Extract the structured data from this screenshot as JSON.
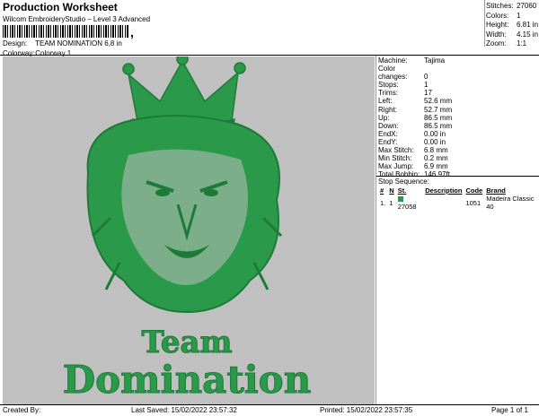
{
  "header": {
    "title": "Production Worksheet",
    "software": "Wilcom EmbroideryStudio – Level 3 Advanced",
    "barcode_suffix": ",",
    "design_label": "Design:",
    "design_value": "TEAM NOMINATION 6,8 in",
    "colorway_label": "Colorway:",
    "colorway_value": "Colorway 1"
  },
  "stats": [
    {
      "label": "Stitches:",
      "value": "27060"
    },
    {
      "label": "Colors:",
      "value": "1"
    },
    {
      "label": "Height:",
      "value": "6.81 in"
    },
    {
      "label": "Width:",
      "value": "4.15 in"
    },
    {
      "label": "Zoom:",
      "value": "1:1"
    }
  ],
  "machine_info": [
    {
      "label": "Machine:",
      "value": "Tajima"
    },
    {
      "label": "Color changes:",
      "value": "0"
    },
    {
      "label": "Stops:",
      "value": "1"
    },
    {
      "label": "Trims:",
      "value": "17"
    },
    {
      "label": "Left:",
      "value": "52.6 mm"
    },
    {
      "label": "Right:",
      "value": "52.7 mm"
    },
    {
      "label": "Up:",
      "value": "86.5 mm"
    },
    {
      "label": "Down:",
      "value": "86.5 mm"
    },
    {
      "label": "EndX:",
      "value": "0.00 in"
    },
    {
      "label": "EndY:",
      "value": "0.00 in"
    },
    {
      "label": "Max Stitch:",
      "value": "6.8 mm"
    },
    {
      "label": "Min Stitch:",
      "value": "0.2 mm"
    },
    {
      "label": "Max Jump:",
      "value": "6.9 mm"
    },
    {
      "label": "Total Bobbin:",
      "value": "146.97ft"
    }
  ],
  "stop_sequence": {
    "title": "Stop Sequence:",
    "columns": [
      "#",
      "N",
      "St.",
      "Description",
      "Code",
      "Brand"
    ],
    "rows": [
      {
        "num": "1.",
        "n": "1",
        "stitches": "27058",
        "description": "",
        "code": "1051",
        "brand": "Madeira Classic 40",
        "color": "#2a9a4a"
      }
    ]
  },
  "design_text": {
    "line1": "Team",
    "line2": "Domination"
  },
  "colors": {
    "thread": "#2a9a4a",
    "thread_dark": "#1d7a38",
    "canvas": "#c0c0c0"
  },
  "footer": {
    "created": "Created By:",
    "last_saved": "Last Saved: 15/02/2022 23:57:32",
    "printed": "Printed: 15/02/2022 23:57:35",
    "page": "Page 1 of 1"
  }
}
